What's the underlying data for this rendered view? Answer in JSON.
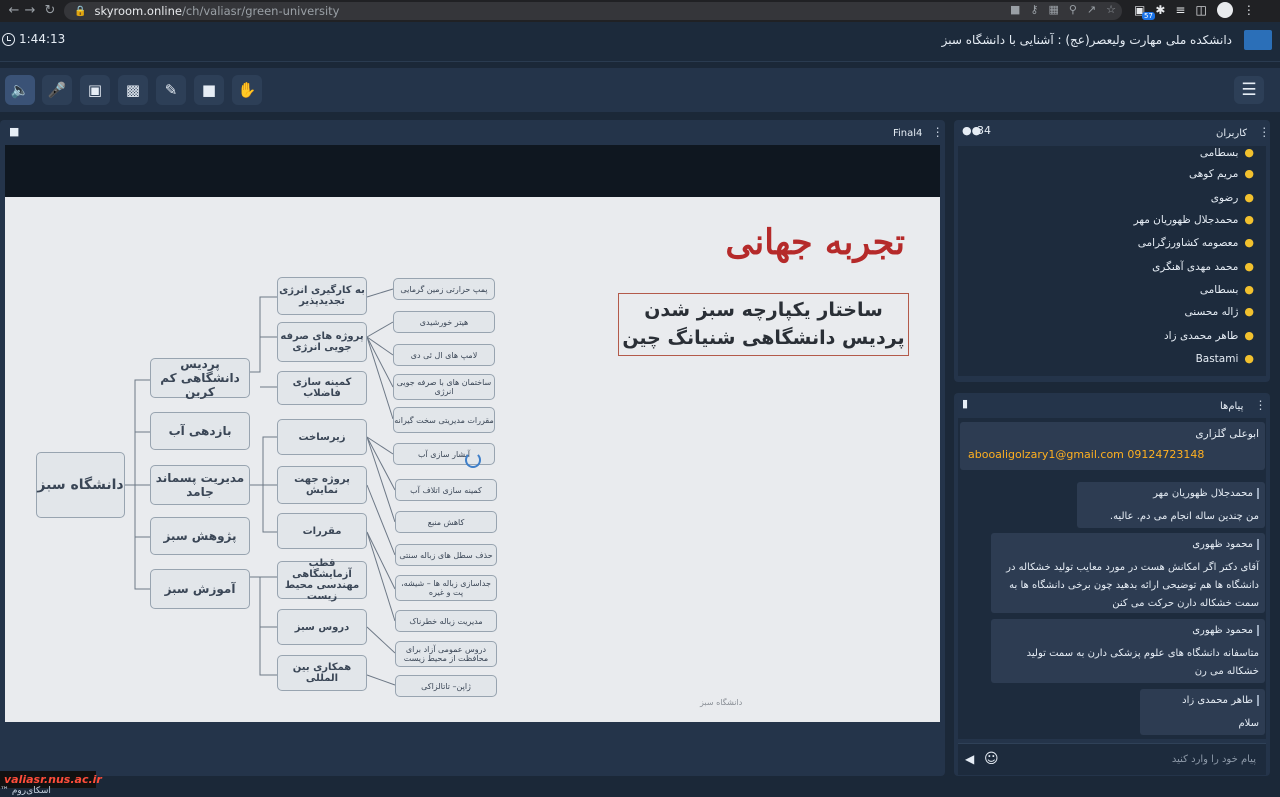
{
  "browser": {
    "url_host": "skyroom.online",
    "url_path": "/ch/valiasr/green-university",
    "ext_badge": "57"
  },
  "header": {
    "timer": "1:44:13",
    "room_title": "دانشکده ملی مهارت ولیعصر(عج) : آشنایی با دانشگاه سبز"
  },
  "toolbar": {
    "tools": [
      "speaker-icon",
      "mic-muted-icon",
      "camera-off-icon",
      "screen-share-icon",
      "brush-icon",
      "folder-icon",
      "hand-icon"
    ],
    "accent": "#5fb6ff"
  },
  "presentation": {
    "file_name": "Final4",
    "slide": {
      "title": "تجربه جهانی",
      "subtitle": "ساختار یکپارچه سبز شدن پردیس دانشگاهی شنیانگ چین",
      "footer": "دانشگاه سبز",
      "root": "دانشگاه سبز",
      "level1": [
        "پردیس دانشگاهی کم کربن",
        "بازدهی آب",
        "مدیریت پسماند جامد",
        "پژوهش سبز",
        "آموزش سبز"
      ],
      "level2": [
        "به کارگیری انرژی تجدیدپذیر",
        "پروژه های صرفه جویی انرژی",
        "کمینه سازی فاضلاب",
        "زیرساخت",
        "پروژه جهت نمایش",
        "مقررات",
        "قطب آزمایشگاهی مهندسی محیط زیست",
        "دروس سبز",
        "همکاری بین المللی"
      ],
      "level3": [
        "پمپ حرارتی زمین گرمایی",
        "هیتر خورشیدی",
        "لامپ های ال ئی دی",
        "ساختمان های با صرفه جویی انرژی",
        "مقررات مدیریتی سخت گیرانه",
        "آبشار سازی آب",
        "کمینه سازی اتلاف آب",
        "کاهش منبع",
        "حذف سطل های زباله سنتی",
        "جداسازی زباله ها – شیشه، پت و غیره",
        "مدیریت زباله خطرناک",
        "دروس عمومی آزاد برای محافظت از محیط زیست",
        "ژاپن– تاتالزاکی"
      ]
    }
  },
  "users": {
    "label": "کاربران",
    "count": "34",
    "list": [
      "بسطامی",
      "مریم کوهی",
      "رضوی",
      "محمدجلال ظهوریان مهر",
      "معصومه کشاورزگرامی",
      "محمد مهدی آهنگری",
      "بسطامی",
      "ژاله محسنی",
      "طاهر محمدی زاد",
      "Bastami"
    ],
    "icon_color": "#f2c12e"
  },
  "chat": {
    "label": "پیام‌ها",
    "messages": [
      {
        "sender": "ابوعلی گلزاری",
        "text": "abooaligolzary1@gmail.com 09124723148"
      },
      {
        "sender": "محمدجلال ظهوریان مهر",
        "text": "من چندین ساله انجام می دم. عالیه."
      },
      {
        "sender": "محمود ظهوری",
        "text": "آقای دکتر اگر امکانش هست در مورد معایب تولید خشکاله در دانشگاه ها هم توضیحی ارائه بدهید چون برخی دانشگاه ها به سمت خشکاله دارن حرکت می کنن"
      },
      {
        "sender": "محمود ظهوری",
        "text": "متاسفانه دانشگاه های علوم پزشکی دارن به سمت تولید خشکاله می رن"
      },
      {
        "sender": "طاهر محمدی زاد",
        "text": "سلام"
      }
    ],
    "input_placeholder": "پیام خود را وارد کنید",
    "link_color": "#ffb020"
  },
  "footer": {
    "watermark": "valiasr.nus.ac.ir",
    "app_name": "اسکای‌روم ™"
  }
}
